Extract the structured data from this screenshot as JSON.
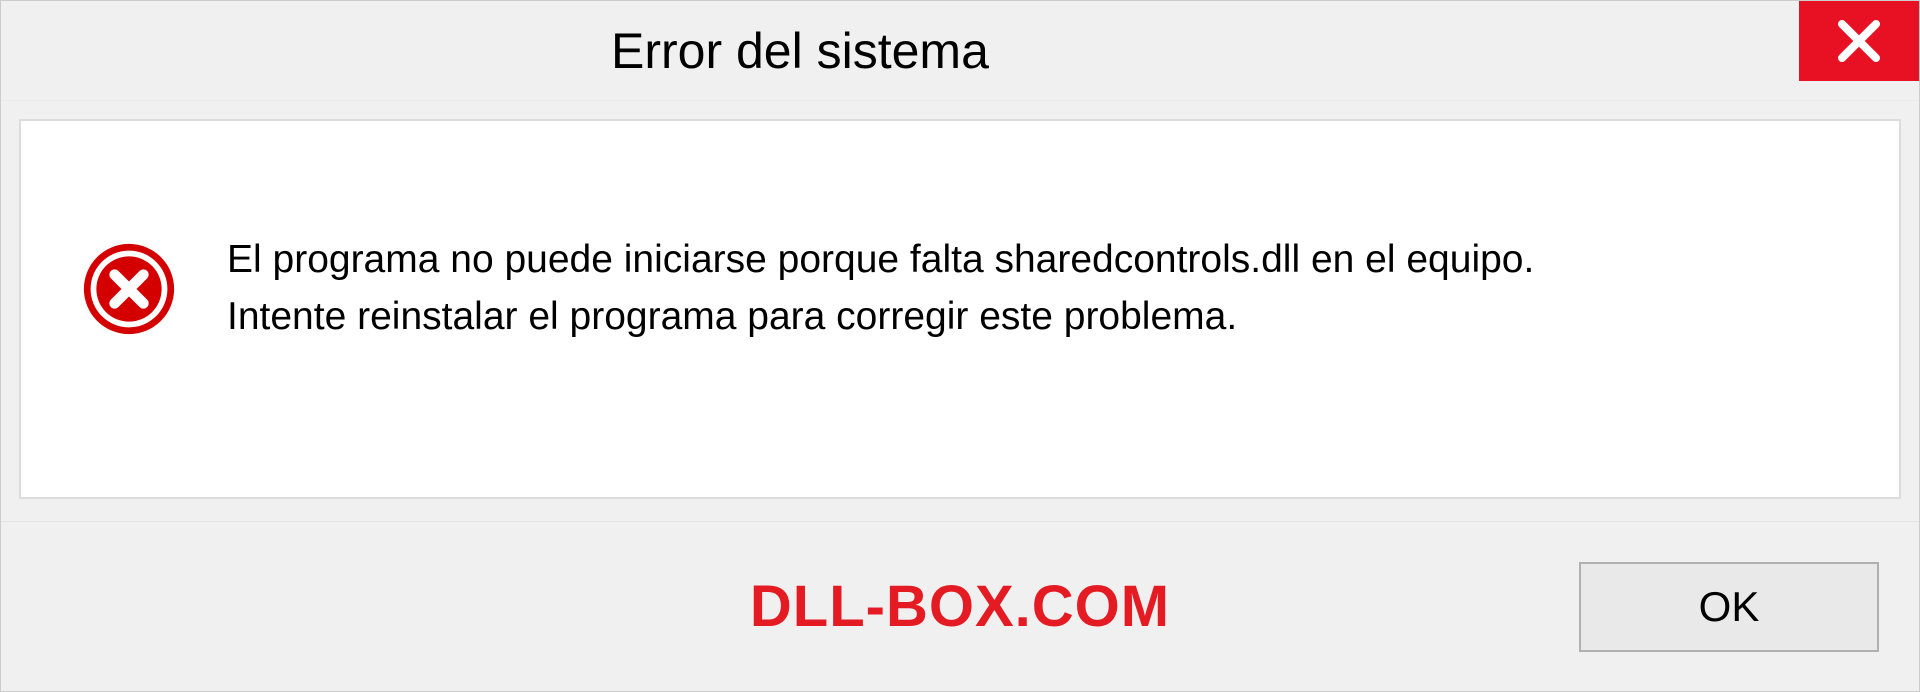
{
  "titlebar": {
    "title": "Error del sistema"
  },
  "message": {
    "line1": "El programa no puede iniciarse porque falta sharedcontrols.dll en el equipo.",
    "line2": "Intente reinstalar el programa para corregir este problema."
  },
  "footer": {
    "watermark": "DLL-BOX.COM",
    "ok_label": "OK"
  },
  "colors": {
    "close_bg": "#e81123",
    "error_icon": "#d40000",
    "watermark": "#e41b23"
  }
}
